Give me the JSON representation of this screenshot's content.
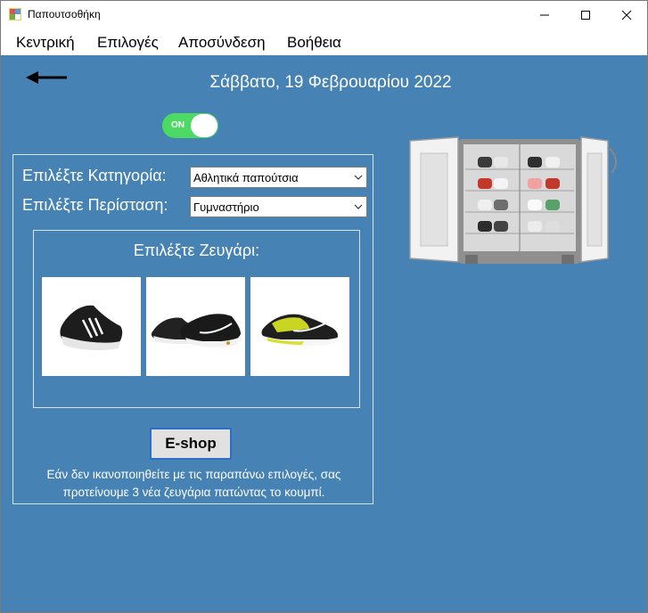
{
  "window": {
    "title": "Παπουτσοθήκη",
    "controls": {
      "minimize": "minimize-icon",
      "maximize": "maximize-icon",
      "close": "close-icon"
    }
  },
  "menu": {
    "items": [
      {
        "label": "Κεντρική"
      },
      {
        "label": "Επιλογές"
      },
      {
        "label": "Αποσύνδεση"
      },
      {
        "label": "Βοήθεια"
      }
    ]
  },
  "header": {
    "date": "Σάββατο, 19 Φεβρουαρίου 2022"
  },
  "toggle": {
    "label": "ON",
    "state": "on"
  },
  "form": {
    "category_label": "Επιλέξτε Κατηγορία:",
    "category_value": "Αθλητικά παπούτσια",
    "occasion_label": "Επιλέξτε Περίσταση:",
    "occasion_value": "Γυμναστήριο",
    "pair_title": "Επιλέξτε Ζευγάρι:",
    "shoes": [
      {
        "icon": "black-white-stripe-sneaker"
      },
      {
        "icon": "black-white-swoosh-sneaker"
      },
      {
        "icon": "volt-yellow-black-sneaker"
      }
    ],
    "eshop_label": "E-shop",
    "note": "Εάν δεν ικανοποιηθείτε με τις παραπάνω επιλογές, σας προτείνουμε 3 νέα ζευγάρια πατώντας το κουμπί."
  },
  "colors": {
    "background": "#4682b4",
    "toggle_on": "#4cd964",
    "button_border": "#2b6fc9"
  }
}
